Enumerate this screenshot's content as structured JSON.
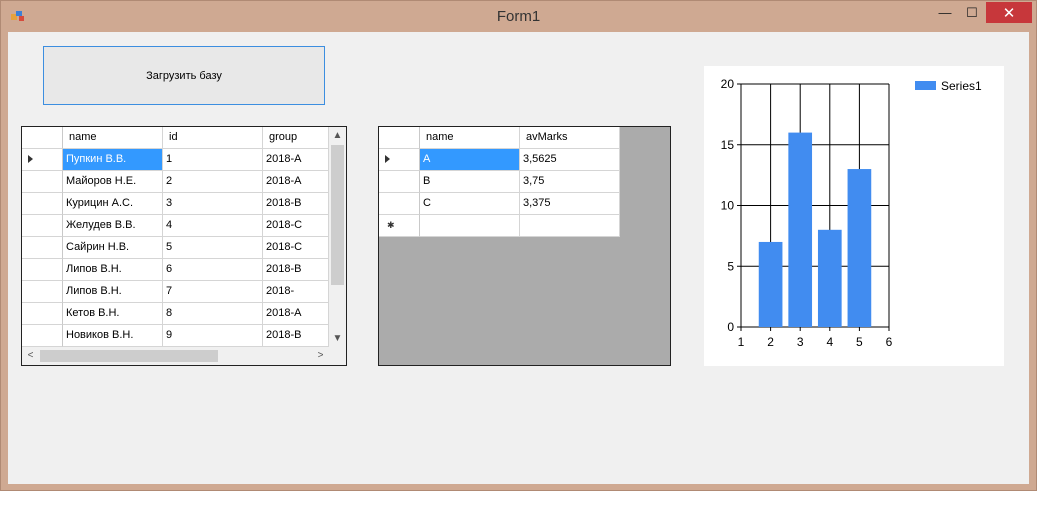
{
  "window": {
    "title": "Form1",
    "minimize_glyph": "—",
    "maximize_glyph": "☐",
    "close_glyph": "✕"
  },
  "load_button": {
    "label": "Загрузить базу"
  },
  "students_grid": {
    "columns": [
      "name",
      "id",
      "group"
    ],
    "rows": [
      [
        "Пупкин В.В.",
        "1",
        "2018-A"
      ],
      [
        "Майоров Н.Е.",
        "2",
        "2018-A"
      ],
      [
        "Курицин А.С.",
        "3",
        "2018-B"
      ],
      [
        "Желудев В.В.",
        "4",
        "2018-C"
      ],
      [
        "Сайрин Н.В.",
        "5",
        "2018-C"
      ],
      [
        "Липов В.Н.",
        "6",
        "2018-B"
      ],
      [
        "Липов В.Н.",
        "7",
        "2018-"
      ],
      [
        "Кетов В.Н.",
        "8",
        "2018-A"
      ],
      [
        "Новиков В.Н.",
        "9",
        "2018-B"
      ]
    ],
    "scroll_up": "▲",
    "scroll_down": "▼",
    "scroll_left": "<",
    "scroll_right": ">"
  },
  "marks_grid": {
    "columns": [
      "name",
      "avMarks"
    ],
    "rows": [
      [
        "A",
        "3,5625"
      ],
      [
        "B",
        "3,75"
      ],
      [
        "C",
        "3,375"
      ]
    ],
    "new_row_glyph": "✱"
  },
  "chart_data": {
    "type": "bar",
    "x": [
      2,
      3,
      4,
      5
    ],
    "series": [
      {
        "name": "Series1",
        "values": [
          7,
          16,
          8,
          13
        ],
        "color": "#418cf0"
      }
    ],
    "xlim": [
      1,
      6
    ],
    "ylim": [
      0,
      20
    ],
    "xticks": [
      "1",
      "2",
      "3",
      "4",
      "5",
      "6"
    ],
    "yticks": [
      "0",
      "5",
      "10",
      "15",
      "20"
    ],
    "grid": true,
    "legend": "top-right"
  },
  "colors": {
    "accent": "#3399ff",
    "close_red": "#c7373b",
    "frame": "#cfa992"
  }
}
